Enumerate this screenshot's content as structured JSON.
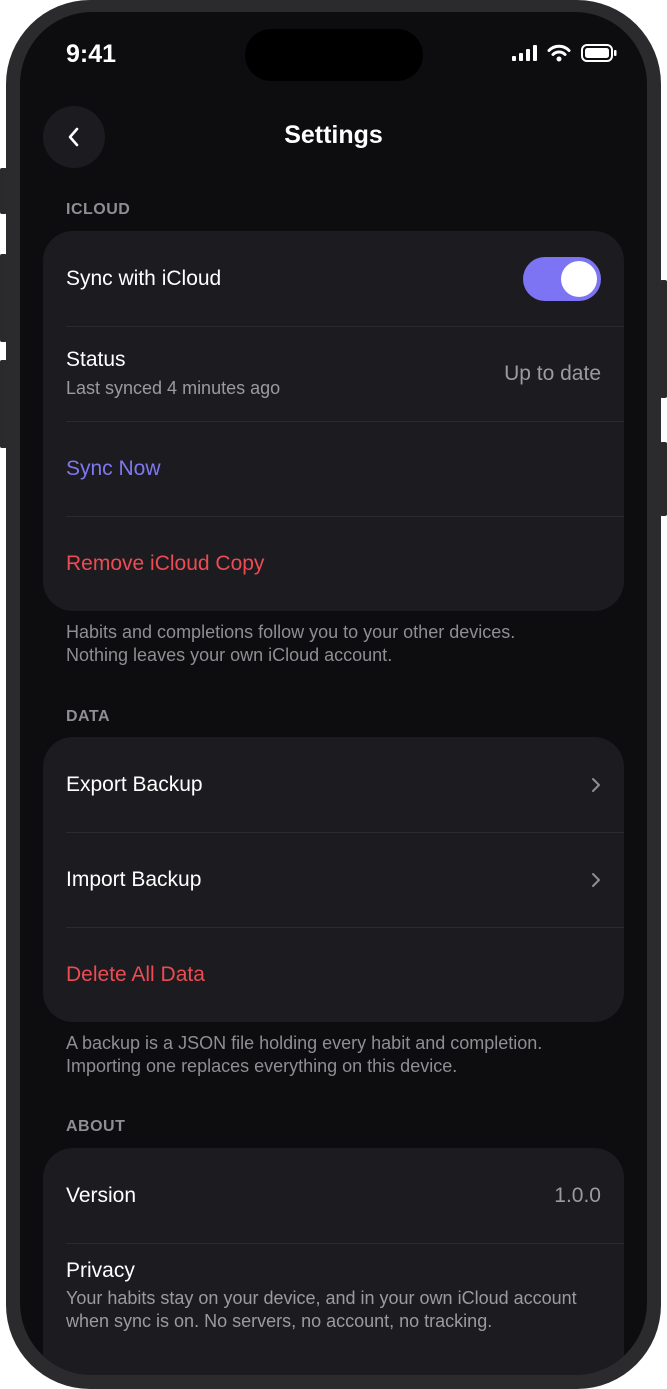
{
  "status_bar": {
    "time": "9:41"
  },
  "nav": {
    "title": "Settings"
  },
  "icloud": {
    "header": "ICLOUD",
    "sync_label": "Sync with iCloud",
    "sync_enabled": true,
    "status_label": "Status",
    "status_sub": "Last synced 4 minutes ago",
    "status_value": "Up to date",
    "sync_now": "Sync Now",
    "remove_copy": "Remove iCloud Copy",
    "footnote_1": "Habits and completions follow you to your other devices.",
    "footnote_2": "Nothing leaves your own iCloud account."
  },
  "data": {
    "header": "DATA",
    "export": "Export Backup",
    "import": "Import Backup",
    "delete": "Delete All Data",
    "footnote_1": "A backup is a JSON file holding every habit and completion.",
    "footnote_2": "Importing one replaces everything on this device."
  },
  "about": {
    "header": "ABOUT",
    "version_label": "Version",
    "version_value": "1.0.0",
    "privacy_label": "Privacy",
    "privacy_text": "Your habits stay on your device, and in your own iCloud account when sync is on. No servers, no account, no tracking."
  },
  "colors": {
    "accent": "#7c74f2",
    "destructive": "#ec4b53",
    "background": "#0d0d0f",
    "card": "#1c1c20"
  }
}
